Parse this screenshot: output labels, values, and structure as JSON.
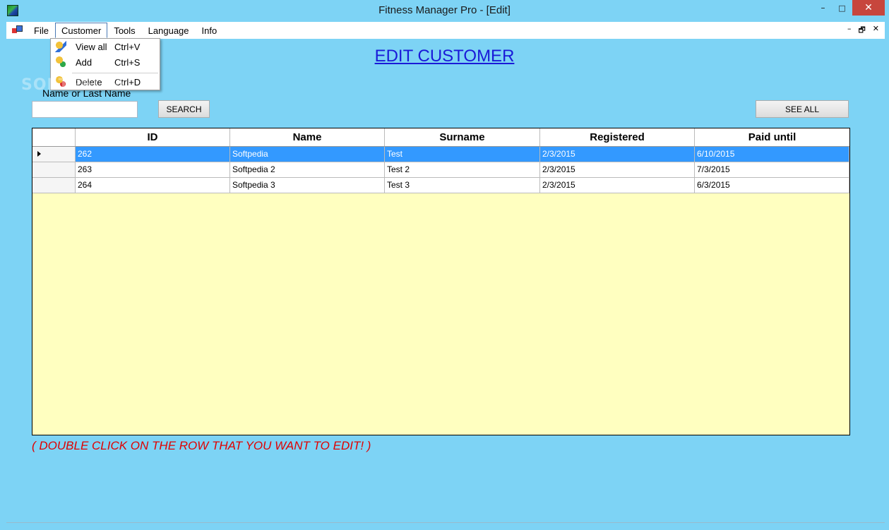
{
  "window": {
    "title": "Fitness Manager Pro - [Edit]",
    "minimize": "–",
    "maximize": "□",
    "close": "✕"
  },
  "menubar": {
    "items": [
      "File",
      "Customer",
      "Tools",
      "Language",
      "Info"
    ],
    "mdi_minimize": "–",
    "mdi_restore": "🗗",
    "mdi_close": "✕"
  },
  "customer_menu": {
    "items": [
      {
        "label": "View all",
        "shortcut": "Ctrl+V",
        "icon": "user-edit-icon"
      },
      {
        "label": "Add",
        "shortcut": "Ctrl+S",
        "icon": "user-add-icon"
      },
      {
        "label": "Delete",
        "shortcut": "Ctrl+D",
        "icon": "user-delete-icon"
      }
    ]
  },
  "watermark": "SOFTPEDIA",
  "page": {
    "title": "EDIT CUSTOMER",
    "search_label": "Name or Last Name",
    "search_value": "",
    "search_button": "SEARCH",
    "see_all_button": "SEE ALL",
    "hint": "( DOUBLE CLICK ON THE ROW THAT YOU WANT TO EDIT! )"
  },
  "grid": {
    "columns": [
      "ID",
      "Name",
      "Surname",
      "Registered",
      "Paid until"
    ],
    "rows": [
      [
        "262",
        "Softpedia",
        "Test",
        "2/3/2015",
        "6/10/2015"
      ],
      [
        "263",
        "Softpedia 2",
        "Test 2",
        "2/3/2015",
        "7/3/2015"
      ],
      [
        "264",
        "Softpedia 3",
        "Test 3",
        "2/3/2015",
        "6/3/2015"
      ]
    ],
    "selected_row": 0
  },
  "colors": {
    "background": "#7dd3f5",
    "title_blue": "#1a1ad8",
    "hint_red": "#e00000",
    "selection": "#3399ff",
    "grid_empty": "#ffffc0"
  }
}
